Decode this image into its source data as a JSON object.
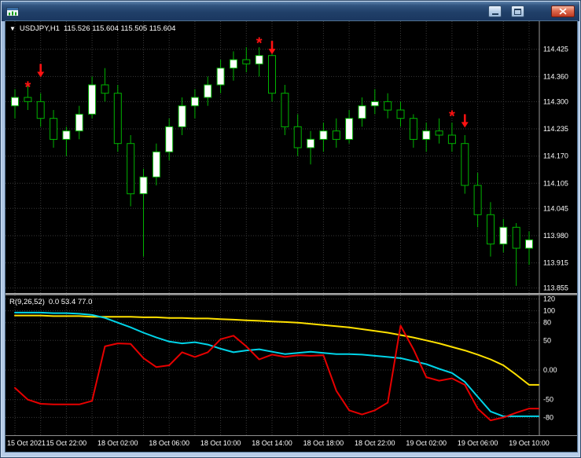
{
  "window": {
    "title": ""
  },
  "price_chart": {
    "dropdown_glyph": "▼",
    "symbol_period": "USDJPY,H1",
    "ohlc_text": "115.526 115.604 115.505 115.604",
    "axis_labels": [
      "114.425",
      "114.360",
      "114.300",
      "114.235",
      "114.170",
      "114.105",
      "114.045",
      "113.980",
      "113.915",
      "113.855"
    ]
  },
  "indicator_pane": {
    "label": "R(9,26,52)",
    "values_text": "0.0 53.4 77.0",
    "axis_labels": [
      "120",
      "100",
      "80",
      "50",
      "0.00",
      "-50",
      "-80"
    ]
  },
  "time_axis": {
    "labels": [
      "15 Oct 2021",
      "15 Oct 22:00",
      "18 Oct 02:00",
      "18 Oct 06:00",
      "18 Oct 10:00",
      "18 Oct 14:00",
      "18 Oct 18:00",
      "18 Oct 22:00",
      "19 Oct 02:00",
      "19 Oct 06:00",
      "19 Oct 10:00"
    ]
  },
  "colors": {
    "pane_bg": "#000000",
    "grid": "#3a3a3a",
    "axis_line": "#9a9a9a",
    "axis_text": "#ffffff",
    "bull": "#ffffff",
    "bear": "#000000",
    "candle_outline": "#00b400",
    "signal": "#ff1212",
    "yellow_line": "#ffe100",
    "cyan_line": "#00d4e8",
    "red_line": "#e60000"
  },
  "chart_data": {
    "type": "candlestick",
    "symbol": "USDJPY",
    "timeframe": "H1",
    "price_ylim": [
      113.843,
      114.492
    ],
    "candles": [
      [
        114.29,
        114.33,
        114.26,
        114.31
      ],
      [
        114.31,
        114.34,
        114.28,
        114.3
      ],
      [
        114.3,
        114.32,
        114.24,
        114.26
      ],
      [
        114.26,
        114.28,
        114.19,
        114.21
      ],
      [
        114.21,
        114.24,
        114.17,
        114.23
      ],
      [
        114.23,
        114.29,
        114.21,
        114.27
      ],
      [
        114.27,
        114.36,
        114.26,
        114.34
      ],
      [
        114.34,
        114.38,
        114.3,
        114.32
      ],
      [
        114.32,
        114.34,
        114.18,
        114.2
      ],
      [
        114.2,
        114.22,
        114.05,
        114.08
      ],
      [
        114.08,
        114.14,
        113.93,
        114.12
      ],
      [
        114.12,
        114.2,
        114.1,
        114.18
      ],
      [
        114.18,
        114.26,
        114.16,
        114.24
      ],
      [
        114.24,
        114.31,
        114.22,
        114.29
      ],
      [
        114.29,
        114.33,
        114.26,
        114.31
      ],
      [
        114.31,
        114.36,
        114.29,
        114.34
      ],
      [
        114.34,
        114.4,
        114.32,
        114.38
      ],
      [
        114.38,
        114.42,
        114.35,
        114.4
      ],
      [
        114.4,
        114.43,
        114.37,
        114.39
      ],
      [
        114.39,
        114.43,
        114.36,
        114.41
      ],
      [
        114.41,
        114.42,
        114.3,
        114.32
      ],
      [
        114.32,
        114.34,
        114.22,
        114.24
      ],
      [
        114.24,
        114.27,
        114.17,
        114.19
      ],
      [
        114.19,
        114.23,
        114.15,
        114.21
      ],
      [
        114.21,
        114.25,
        114.18,
        114.23
      ],
      [
        114.23,
        114.26,
        114.19,
        114.21
      ],
      [
        114.21,
        114.28,
        114.2,
        114.26
      ],
      [
        114.26,
        114.31,
        114.24,
        114.29
      ],
      [
        114.29,
        114.33,
        114.27,
        114.3
      ],
      [
        114.3,
        114.32,
        114.26,
        114.28
      ],
      [
        114.28,
        114.3,
        114.24,
        114.26
      ],
      [
        114.26,
        114.27,
        114.19,
        114.21
      ],
      [
        114.21,
        114.25,
        114.18,
        114.23
      ],
      [
        114.23,
        114.26,
        114.2,
        114.22
      ],
      [
        114.22,
        114.25,
        114.18,
        114.2
      ],
      [
        114.2,
        114.22,
        114.08,
        114.1
      ],
      [
        114.1,
        114.13,
        114.0,
        114.03
      ],
      [
        114.03,
        114.06,
        113.93,
        113.96
      ],
      [
        113.96,
        114.02,
        113.94,
        114.0
      ],
      [
        114.0,
        114.01,
        113.86,
        113.95
      ],
      [
        113.95,
        113.99,
        113.91,
        113.97
      ]
    ],
    "signals": [
      {
        "index": 1,
        "price": 114.345,
        "kind": "star"
      },
      {
        "index": 2,
        "price": 114.39,
        "kind": "arrow"
      },
      {
        "index": 19,
        "price": 114.45,
        "kind": "star"
      },
      {
        "index": 20,
        "price": 114.445,
        "kind": "arrow"
      },
      {
        "index": 34,
        "price": 114.275,
        "kind": "star"
      },
      {
        "index": 35,
        "price": 114.27,
        "kind": "arrow"
      }
    ],
    "oscillator": {
      "type": "line",
      "ylim": [
        -110,
        126
      ],
      "levels": [
        120,
        100,
        80,
        50,
        0,
        -50,
        -80
      ],
      "series": [
        {
          "name": "slow",
          "color": "yellow_line",
          "values": [
            92,
            92,
            92,
            91,
            91,
            91,
            90,
            90,
            90,
            90,
            89,
            89,
            88,
            88,
            87,
            87,
            86,
            85,
            84,
            83,
            82,
            81,
            80,
            78,
            76,
            74,
            72,
            69,
            66,
            63,
            59,
            55,
            50,
            45,
            39,
            33,
            26,
            18,
            8,
            -8,
            -25
          ]
        },
        {
          "name": "mid",
          "color": "cyan_line",
          "values": [
            97,
            97,
            97,
            96,
            96,
            95,
            93,
            88,
            80,
            72,
            63,
            55,
            48,
            45,
            47,
            43,
            36,
            30,
            33,
            35,
            31,
            27,
            29,
            31,
            29,
            27,
            27,
            26,
            24,
            22,
            20,
            15,
            10,
            2,
            -5,
            -20,
            -45,
            -70,
            -78,
            -78,
            -78
          ]
        },
        {
          "name": "fast",
          "color": "red_line",
          "values": [
            -30,
            -50,
            -57,
            -58,
            -58,
            -58,
            -52,
            40,
            45,
            44,
            20,
            5,
            8,
            30,
            22,
            30,
            52,
            58,
            40,
            18,
            26,
            22,
            25,
            24,
            25,
            -35,
            -68,
            -75,
            -68,
            -55,
            75,
            35,
            -12,
            -18,
            -14,
            -25,
            -65,
            -85,
            -80,
            -72,
            -65
          ]
        }
      ]
    }
  }
}
